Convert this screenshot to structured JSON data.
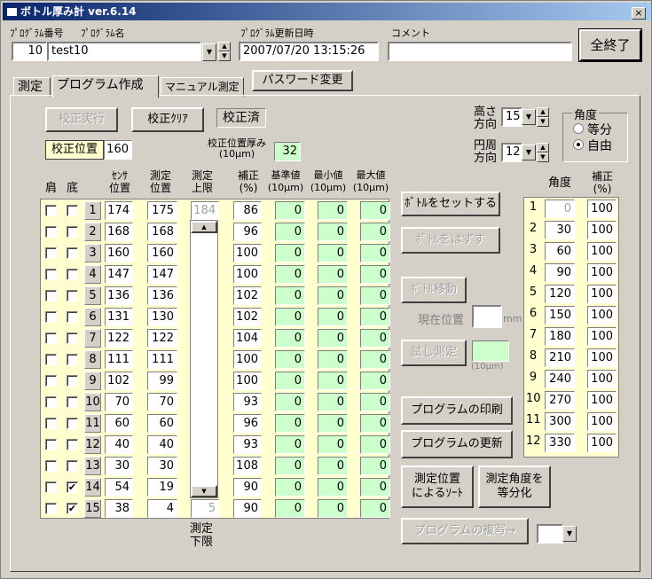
{
  "window": {
    "title": "ボトル厚み計 ver.6.14",
    "close": "×"
  },
  "header": {
    "prog_no_label": "ﾌﾟﾛｸﾞﾗﾑ番号",
    "prog_no": "10",
    "prog_name_label": "ﾌﾟﾛｸﾞﾗﾑ名",
    "prog_name": "test10",
    "updated_label": "ﾌﾟﾛｸﾞﾗﾑ更新日時",
    "updated": "2007/07/20 13:15:26",
    "comment_label": "コメント",
    "comment": "",
    "exit_button": "全終了"
  },
  "tabs": [
    "測定",
    "プログラム作成",
    "マニュアル測定"
  ],
  "password_button": "パスワード変更",
  "calib": {
    "run": "校正実行",
    "clear": "校正ｸﾘｱ",
    "status": "校正済",
    "pos_label": "校正位置",
    "pos": "160",
    "thick_label": "校正位置厚み\n(10μm)",
    "thick": "32"
  },
  "table_headers": {
    "shoulder": "肩",
    "bottom": "底",
    "sensor": "ｾﾝｻ\n位置",
    "measure": "測定\n位置",
    "upper": "測定\n上限",
    "corr": "補正\n(%)",
    "ref": "基準値\n(10μm)",
    "min": "最小値\n(10μm)",
    "max": "最大値\n(10μm)",
    "lower": "測定\n下限"
  },
  "rows": [
    {
      "n": "1",
      "sensor": "174",
      "pos": "175",
      "upper": "184",
      "corr": "86",
      "ref": "0",
      "min": "0",
      "max": "0",
      "shoulder": false,
      "bottom": false
    },
    {
      "n": "2",
      "sensor": "168",
      "pos": "168",
      "corr": "96",
      "ref": "0",
      "min": "0",
      "max": "0",
      "shoulder": false,
      "bottom": false
    },
    {
      "n": "3",
      "sensor": "160",
      "pos": "160",
      "corr": "100",
      "ref": "0",
      "min": "0",
      "max": "0",
      "shoulder": false,
      "bottom": false
    },
    {
      "n": "4",
      "sensor": "147",
      "pos": "147",
      "corr": "100",
      "ref": "0",
      "min": "0",
      "max": "0",
      "shoulder": false,
      "bottom": false
    },
    {
      "n": "5",
      "sensor": "136",
      "pos": "136",
      "corr": "102",
      "ref": "0",
      "min": "0",
      "max": "0",
      "shoulder": false,
      "bottom": false
    },
    {
      "n": "6",
      "sensor": "131",
      "pos": "130",
      "corr": "102",
      "ref": "0",
      "min": "0",
      "max": "0",
      "shoulder": false,
      "bottom": false
    },
    {
      "n": "7",
      "sensor": "122",
      "pos": "122",
      "corr": "104",
      "ref": "0",
      "min": "0",
      "max": "0",
      "shoulder": false,
      "bottom": false
    },
    {
      "n": "8",
      "sensor": "111",
      "pos": "111",
      "corr": "100",
      "ref": "0",
      "min": "0",
      "max": "0",
      "shoulder": false,
      "bottom": false
    },
    {
      "n": "9",
      "sensor": "102",
      "pos": "99",
      "corr": "100",
      "ref": "0",
      "min": "0",
      "max": "0",
      "shoulder": false,
      "bottom": false
    },
    {
      "n": "10",
      "sensor": "70",
      "pos": "70",
      "corr": "93",
      "ref": "0",
      "min": "0",
      "max": "0",
      "shoulder": false,
      "bottom": false
    },
    {
      "n": "11",
      "sensor": "60",
      "pos": "60",
      "corr": "96",
      "ref": "0",
      "min": "0",
      "max": "0",
      "shoulder": false,
      "bottom": false
    },
    {
      "n": "12",
      "sensor": "40",
      "pos": "40",
      "corr": "93",
      "ref": "0",
      "min": "0",
      "max": "0",
      "shoulder": false,
      "bottom": false
    },
    {
      "n": "13",
      "sensor": "30",
      "pos": "30",
      "corr": "108",
      "ref": "0",
      "min": "0",
      "max": "0",
      "shoulder": false,
      "bottom": false
    },
    {
      "n": "14",
      "sensor": "54",
      "pos": "19",
      "corr": "90",
      "ref": "0",
      "min": "0",
      "max": "0",
      "shoulder": false,
      "bottom": true
    },
    {
      "n": "15",
      "sensor": "38",
      "pos": "4",
      "lower": "5",
      "corr": "90",
      "ref": "0",
      "min": "0",
      "max": "0",
      "shoulder": false,
      "bottom": true
    }
  ],
  "middle": {
    "set_bottle": "ﾎﾞﾄﾙをセットする",
    "remove_bottle": "ﾎﾞﾄﾙをはずす",
    "move_bottle": "ﾎﾞﾄﾙ移動",
    "cur_pos_label": "現在位置",
    "cur_pos_unit": "mm",
    "cur_pos": "",
    "trial": "試し測定",
    "trial_unit": "(10μm)",
    "trial_value": "",
    "print": "プログラムの印刷",
    "update": "プログラムの更新",
    "sort": "測定位置\nによるｿｰﾄ",
    "equal": "測定角度を\n等分化",
    "copy": "プログラムの複写→",
    "copy_target": ""
  },
  "right": {
    "height_label": "高さ\n方向",
    "height": "15",
    "circ_label": "円周\n方向",
    "circ": "12",
    "angle_group": "角度",
    "equal": "等分",
    "free": "自由",
    "selected": "free",
    "angle_hdr": "角度",
    "corr_hdr": "補正\n(%)",
    "angles": [
      {
        "n": "1",
        "a": "0",
        "c": "100"
      },
      {
        "n": "2",
        "a": "30",
        "c": "100"
      },
      {
        "n": "3",
        "a": "60",
        "c": "100"
      },
      {
        "n": "4",
        "a": "90",
        "c": "100"
      },
      {
        "n": "5",
        "a": "120",
        "c": "100"
      },
      {
        "n": "6",
        "a": "150",
        "c": "100"
      },
      {
        "n": "7",
        "a": "180",
        "c": "100"
      },
      {
        "n": "8",
        "a": "210",
        "c": "100"
      },
      {
        "n": "9",
        "a": "240",
        "c": "100"
      },
      {
        "n": "10",
        "a": "270",
        "c": "100"
      },
      {
        "n": "11",
        "a": "300",
        "c": "100"
      },
      {
        "n": "12",
        "a": "330",
        "c": "100"
      }
    ]
  }
}
